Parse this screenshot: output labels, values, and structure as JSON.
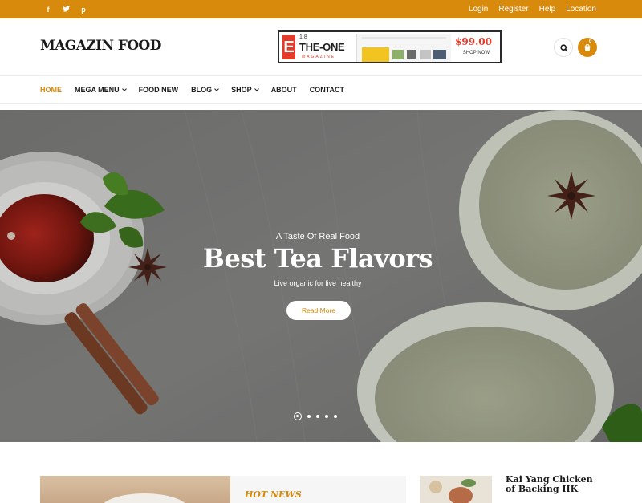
{
  "topbar": {
    "social": [
      {
        "icon": "facebook-icon",
        "glyph": "f"
      },
      {
        "icon": "twitter-icon",
        "glyph": "ᴅ"
      },
      {
        "icon": "pinterest-icon",
        "glyph": "p"
      }
    ],
    "links": [
      "Login",
      "Register",
      "Help",
      "Location"
    ]
  },
  "header": {
    "logo": "MAGAZIN FOOD",
    "banner": {
      "version": "1.8",
      "brand": "THE-ONE",
      "tagline": "MAGAZINE",
      "price": "$99.00",
      "cta": "SHOP NOW"
    },
    "cart_count": "0"
  },
  "nav": {
    "items": [
      {
        "label": "HOME",
        "active": true,
        "has_dropdown": false
      },
      {
        "label": "MEGA MENU",
        "active": false,
        "has_dropdown": true
      },
      {
        "label": "FOOD NEW",
        "active": false,
        "has_dropdown": false
      },
      {
        "label": "BLOG",
        "active": false,
        "has_dropdown": true
      },
      {
        "label": "SHOP",
        "active": false,
        "has_dropdown": true
      },
      {
        "label": "ABOUT",
        "active": false,
        "has_dropdown": false
      },
      {
        "label": "CONTACT",
        "active": false,
        "has_dropdown": false
      }
    ]
  },
  "hero": {
    "subtitle": "A Taste Of Real Food",
    "title": "Best Tea Flavors",
    "tagline": "Live organic for live healthy",
    "button": "Read More",
    "slides": 5,
    "active_slide": 0
  },
  "bottom": {
    "hot_news_label": "HOT NEWS",
    "news_title": "Kai Yang Chicken of Backing IIK"
  },
  "colors": {
    "accent": "#d88a0c",
    "banner_red": "#e53b2b"
  }
}
